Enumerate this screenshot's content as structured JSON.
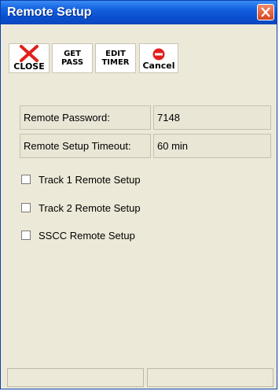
{
  "window": {
    "title": "Remote Setup"
  },
  "toolbar": {
    "close_label": "CLOSE",
    "getpass_line1": "GET",
    "getpass_line2": "PASS",
    "edittimer_line1": "EDIT",
    "edittimer_line2": "TIMER",
    "cancel_label": "Cancel"
  },
  "fields": {
    "password_label": "Remote Password:",
    "password_value": "7148",
    "timeout_label": "Remote Setup Timeout:",
    "timeout_value": "60 min"
  },
  "checkboxes": [
    {
      "label": "Track 1 Remote Setup",
      "checked": false
    },
    {
      "label": "Track 2 Remote Setup",
      "checked": false
    },
    {
      "label": "SSCC Remote Setup",
      "checked": false
    }
  ],
  "statusbar": {
    "pane1": "",
    "pane2": ""
  },
  "colors": {
    "titlebar": "#0a4fd0",
    "close_button": "#d6431f",
    "close_icon": "#e0201c",
    "cancel_icon": "#e0201c"
  },
  "icons": {
    "close": "red-x-icon",
    "cancel": "red-minus-circle-icon",
    "window_close": "close-x-icon"
  }
}
